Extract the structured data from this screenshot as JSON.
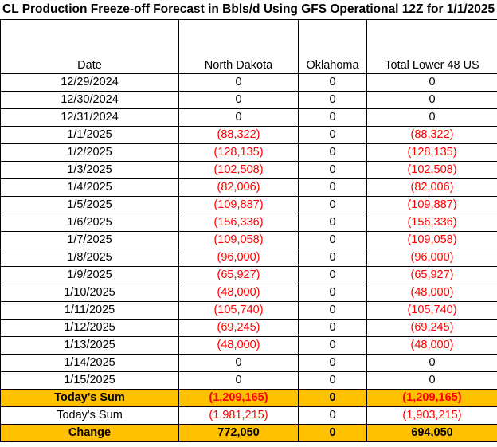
{
  "title": "CL Production Freeze-off Forecast in Bbls/d Using GFS Operational 12Z for 1/1/2025",
  "headers": [
    "Date",
    "North Dakota",
    "Oklahoma",
    "Total Lower 48 US"
  ],
  "rows": [
    {
      "date": "12/29/2024",
      "nd": "0",
      "ok": "0",
      "total": "0",
      "neg": false
    },
    {
      "date": "12/30/2024",
      "nd": "0",
      "ok": "0",
      "total": "0",
      "neg": false
    },
    {
      "date": "12/31/2024",
      "nd": "0",
      "ok": "0",
      "total": "0",
      "neg": false
    },
    {
      "date": "1/1/2025",
      "nd": "(88,322)",
      "ok": "0",
      "total": "(88,322)",
      "neg": true
    },
    {
      "date": "1/2/2025",
      "nd": "(128,135)",
      "ok": "0",
      "total": "(128,135)",
      "neg": true
    },
    {
      "date": "1/3/2025",
      "nd": "(102,508)",
      "ok": "0",
      "total": "(102,508)",
      "neg": true
    },
    {
      "date": "1/4/2025",
      "nd": "(82,006)",
      "ok": "0",
      "total": "(82,006)",
      "neg": true
    },
    {
      "date": "1/5/2025",
      "nd": "(109,887)",
      "ok": "0",
      "total": "(109,887)",
      "neg": true
    },
    {
      "date": "1/6/2025",
      "nd": "(156,336)",
      "ok": "0",
      "total": "(156,336)",
      "neg": true
    },
    {
      "date": "1/7/2025",
      "nd": "(109,058)",
      "ok": "0",
      "total": "(109,058)",
      "neg": true
    },
    {
      "date": "1/8/2025",
      "nd": "(96,000)",
      "ok": "0",
      "total": "(96,000)",
      "neg": true
    },
    {
      "date": "1/9/2025",
      "nd": "(65,927)",
      "ok": "0",
      "total": "(65,927)",
      "neg": true
    },
    {
      "date": "1/10/2025",
      "nd": "(48,000)",
      "ok": "0",
      "total": "(48,000)",
      "neg": true
    },
    {
      "date": "1/11/2025",
      "nd": "(105,740)",
      "ok": "0",
      "total": "(105,740)",
      "neg": true
    },
    {
      "date": "1/12/2025",
      "nd": "(69,245)",
      "ok": "0",
      "total": "(69,245)",
      "neg": true
    },
    {
      "date": "1/13/2025",
      "nd": "(48,000)",
      "ok": "0",
      "total": "(48,000)",
      "neg": true
    },
    {
      "date": "1/14/2025",
      "nd": "0",
      "ok": "0",
      "total": "0",
      "neg": false
    },
    {
      "date": "1/15/2025",
      "nd": "0",
      "ok": "0",
      "total": "0",
      "neg": false
    }
  ],
  "todays_sum": {
    "label": "Today's Sum",
    "nd": "(1,209,165)",
    "ok": "0",
    "total": "(1,209,165)"
  },
  "prior_sum": {
    "label": "Today's Sum",
    "nd": "(1,981,215)",
    "ok": "0",
    "total": "(1,903,215)"
  },
  "change": {
    "label": "Change",
    "nd": "772,050",
    "ok": "0",
    "total": "694,050"
  },
  "colors": {
    "highlight": "#ffc000",
    "negative": "#ff0000"
  }
}
